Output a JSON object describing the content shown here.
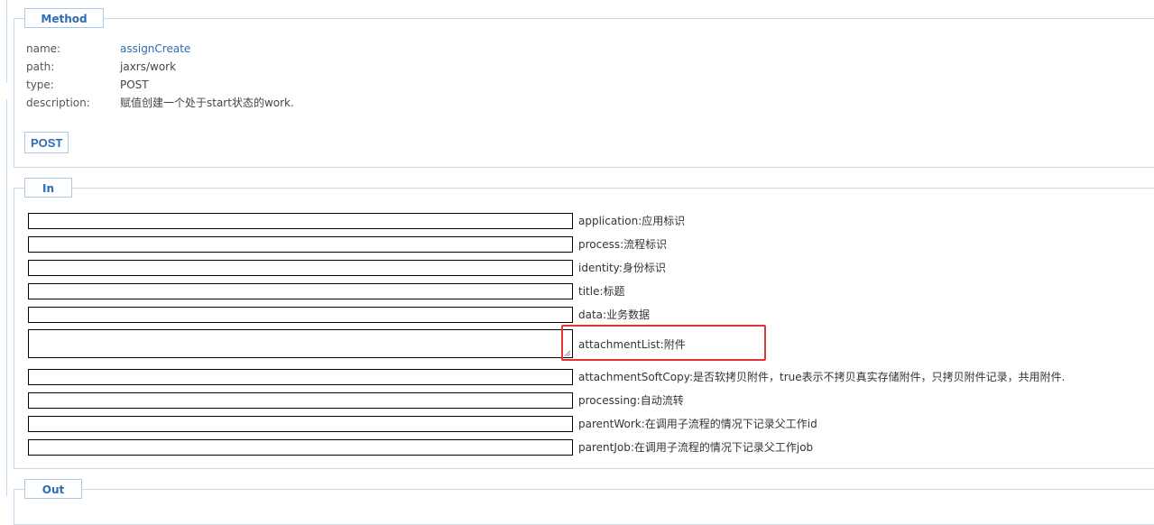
{
  "method_section": {
    "legend": "Method",
    "fields": [
      {
        "key": "name:",
        "value": "assignCreate",
        "link": true
      },
      {
        "key": "path:",
        "value": "jaxrs/work",
        "link": false
      },
      {
        "key": "type:",
        "value": "POST",
        "link": false
      },
      {
        "key": "description:",
        "value": "赋值创建一个处于start状态的work.",
        "link": false
      }
    ],
    "post_button": "POST"
  },
  "in_section": {
    "legend": "In",
    "params": [
      {
        "label": "application:应用标识",
        "value": ""
      },
      {
        "label": "process:流程标识",
        "value": ""
      },
      {
        "label": "identity:身份标识",
        "value": ""
      },
      {
        "label": "title:标题",
        "value": ""
      },
      {
        "label": "data:业务数据",
        "value": ""
      },
      {
        "label": "attachmentList:附件",
        "value": "",
        "multiline": true
      },
      {
        "label": "attachmentSoftCopy:是否软拷贝附件，true表示不拷贝真实存储附件，只拷贝附件记录，共用附件.",
        "value": ""
      },
      {
        "label": "processing:自动流转",
        "value": ""
      },
      {
        "label": "parentWork:在调用子流程的情况下记录父工作id",
        "value": ""
      },
      {
        "label": "parentJob:在调用子流程的情况下记录父工作job",
        "value": ""
      }
    ]
  },
  "out_section": {
    "legend": "Out"
  },
  "colors": {
    "accent": "#2b6cb3",
    "border": "#c5d9ec",
    "highlight": "#e53232"
  }
}
